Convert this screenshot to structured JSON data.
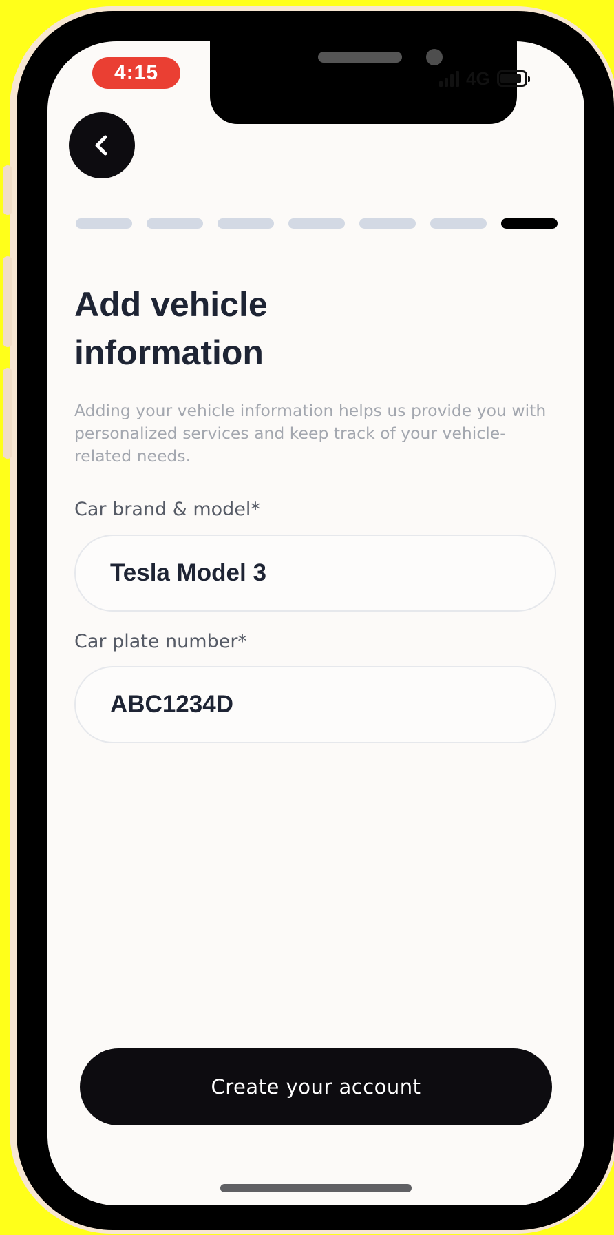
{
  "status_bar": {
    "time": "4:15",
    "network": "4G"
  },
  "progress": {
    "total_steps": 7,
    "current_step": 7
  },
  "page": {
    "title": "Add vehicle information",
    "subtitle": "Adding your vehicle information helps us provide you with personalized services and keep track of your vehicle-related needs."
  },
  "form": {
    "car_model": {
      "label": "Car brand & model*",
      "value": "Tesla Model 3"
    },
    "plate_number": {
      "label": "Car plate number*",
      "value": "ABC1234D"
    }
  },
  "actions": {
    "submit_label": "Create your account"
  },
  "icons": {
    "back": "chevron-left-icon",
    "signal": "signal-icon",
    "battery": "battery-icon"
  },
  "colors": {
    "background": "#ffff1a",
    "screen": "#fcfaf8",
    "time_pill": "#ea3f33",
    "primary_button": "#0d0c10",
    "heading": "#1e2434",
    "muted_text": "#a3a7af",
    "progress_inactive": "#d3d9e4",
    "progress_active": "#000000"
  }
}
